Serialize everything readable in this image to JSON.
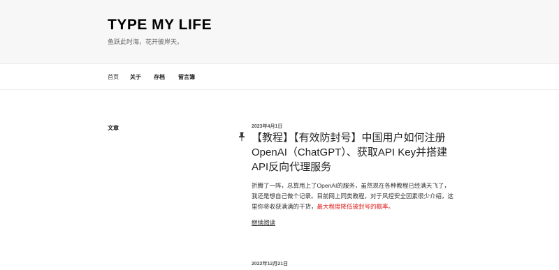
{
  "header": {
    "site_title": "TYPE MY LIFE",
    "site_description": "鱼跃此时海，花开彼岸天。"
  },
  "nav": {
    "items": [
      {
        "label": "首页"
      },
      {
        "label": "关于"
      },
      {
        "label": "存档"
      },
      {
        "label": "留言簿"
      }
    ]
  },
  "sidebar": {
    "heading": "文章"
  },
  "posts": [
    {
      "date": "2023年4月1日",
      "title": "【教程】【有效防封号】中国用户如何注册OpenAI（ChatGPT）、获取API Key并搭建API反向代理服务",
      "excerpt_text": "折腾了一阵，总算用上了OpenAI的服务，虽然现在各种教程已经满天飞了，我还是想自己做个记录。目前网上同类教程，对于风控安全因素很少介绍，这里你将收获满满的干货，",
      "excerpt_highlight": "最大程度降低被封号的概率。",
      "read_more": "继续阅读",
      "pinned": true
    },
    {
      "date": "2022年12月21日"
    }
  ],
  "colors": {
    "header_bg": "#f7f7f7",
    "highlight": "#e02020"
  },
  "icons": {
    "pin": "pushpin-icon"
  }
}
